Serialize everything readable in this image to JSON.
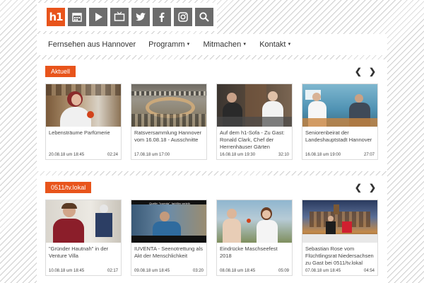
{
  "header": {
    "logo_text": "h1",
    "icons": [
      "calendar-icon",
      "play-icon",
      "tv-icon",
      "twitter-icon",
      "facebook-icon",
      "instagram-icon",
      "search-icon"
    ],
    "brand_color": "#e8541b",
    "icon_bg": "#6c6c6c"
  },
  "nav": {
    "items": [
      {
        "label": "Fernsehen aus Hannover"
      },
      {
        "label": "Programm"
      },
      {
        "label": "Mitmachen"
      },
      {
        "label": "Kontakt"
      }
    ]
  },
  "sections": [
    {
      "badge": "Aktuell",
      "cards": [
        {
          "title": "Lebensträume Parfümerie",
          "date": "20.08.18 um 18:45",
          "duration": "02:24"
        },
        {
          "title": "Ratsversammlung Hannover vom 16.08.18 - Ausschnitte",
          "date": "17.08.18 um 17:00",
          "duration": ""
        },
        {
          "title": "Auf dem h1-Sofa - Zu Gast: Ronald Clark, Chef der Herrenhäuser Gärten",
          "date": "16.08.18 um 19:30",
          "duration": "32:10"
        },
        {
          "title": "Seniorenbeirat der Landeshauptstadt Hannover",
          "date": "16.08.18 um 19:00",
          "duration": "27:07"
        }
      ]
    },
    {
      "badge": "0511/tv.lokal",
      "cards": [
        {
          "title": "\"Gründer Hautnah\" in der Venture Villa",
          "date": "10.08.18 um 18:45",
          "duration": "02:17"
        },
        {
          "title": "IUVENTA - Seenotrettung als Akt der Menschlichkeit",
          "date": "09.08.18 um 18:45",
          "duration": "03:20",
          "overlay": "Quelle: \"iuventa\", farbfilm verleih"
        },
        {
          "title": "Eindrücke Maschseefest 2018",
          "date": "08.08.18 um 18:45",
          "duration": "05:09"
        },
        {
          "title": "Sebastian Rose vom Flüchtlingsrat Niedersachsen zu Gast bei 0511/tv.lokal",
          "date": "07.08.18 um 18:45",
          "duration": "04:54"
        }
      ]
    }
  ]
}
